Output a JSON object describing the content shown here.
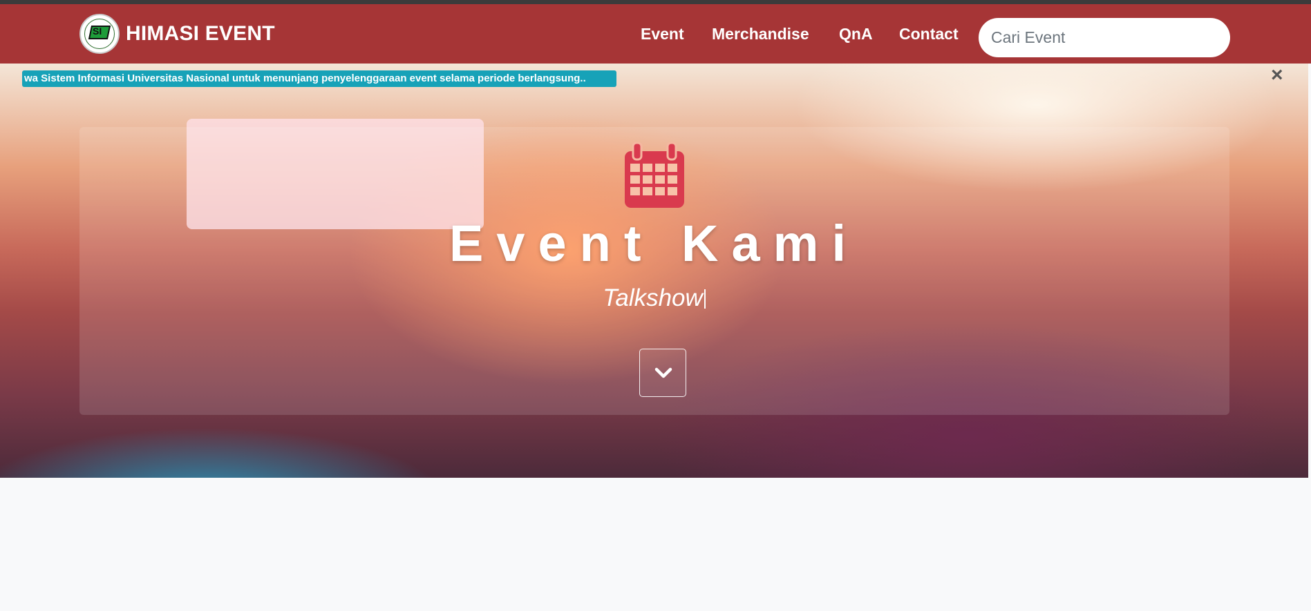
{
  "brand": {
    "name": "HIMASI EVENT",
    "logo_text": "SI"
  },
  "nav": {
    "items": [
      "Event",
      "Merchandise",
      "QnA",
      "Contact"
    ]
  },
  "search": {
    "placeholder": "Cari Event",
    "value": ""
  },
  "ticker": {
    "text": "wa Sistem Informasi Universitas Nasional untuk menunjang penyelenggaraan event selama periode berlangsung..",
    "close": "×"
  },
  "hero": {
    "title": "Event Kami",
    "subtitle": "Talkshow"
  },
  "icons": {
    "calendar": "calendar-icon",
    "scroll": "chevron-down-icon",
    "close": "close-icon"
  },
  "colors": {
    "navbar": "#a63536",
    "ticker": "#17a2b8",
    "calendar": "#d93a4e",
    "page_background": "#f8f9fa"
  }
}
